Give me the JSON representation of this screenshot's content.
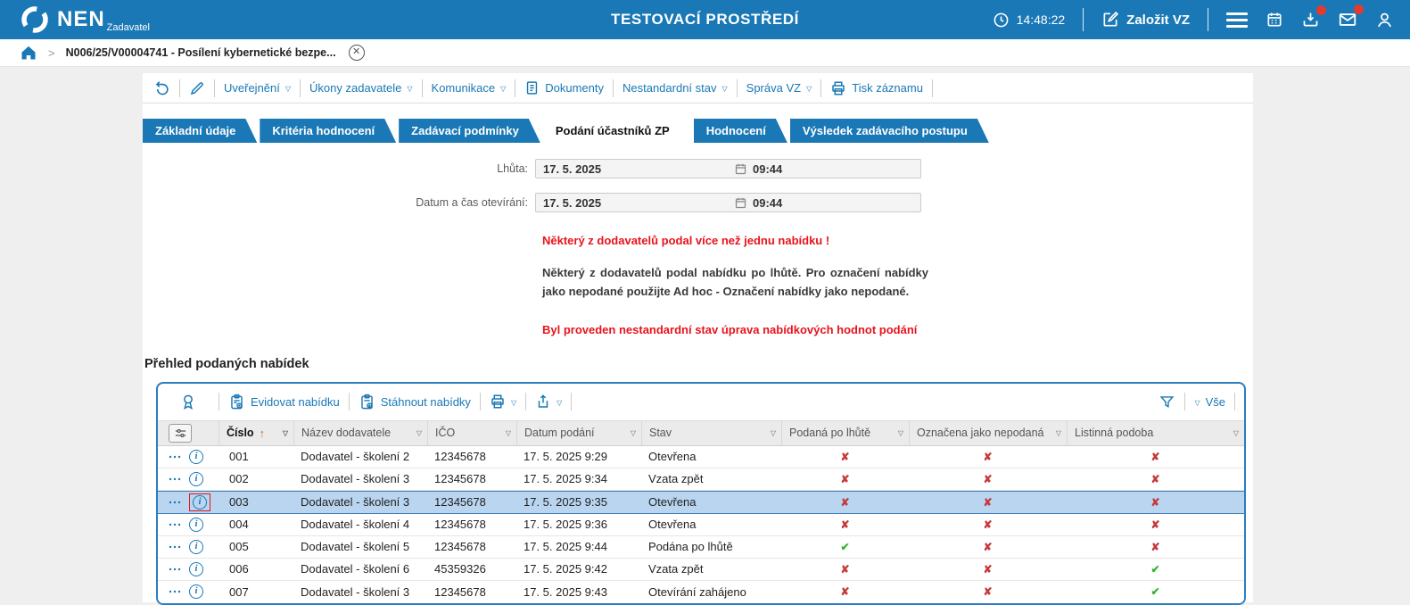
{
  "topbar": {
    "brand": "NEN",
    "brand_sub": "Zadavatel",
    "env_title": "TESTOVACÍ PROSTŘEDÍ",
    "time": "14:48:22",
    "create_vz_label": "Založit VZ"
  },
  "breadcrumb": {
    "item": "N006/25/V00004741 - Posílení kybernetické bezpe..."
  },
  "toolbar": {
    "uverejneni": "Uveřejnění",
    "ukony_zadavatele": "Úkony zadavatele",
    "komunikace": "Komunikace",
    "dokumenty": "Dokumenty",
    "nestandardni_stav": "Nestandardní stav",
    "sprava_vz": "Správa VZ",
    "tisk_zaznamu": "Tisk záznamu"
  },
  "tabs": [
    "Základní údaje",
    "Kritéria hodnocení",
    "Zadávací podmínky",
    "Podání účastníků ZP",
    "Hodnocení",
    "Výsledek zadávacího postupu"
  ],
  "active_tab": "Podání účastníků ZP",
  "form": {
    "deadline_label": "Lhůta:",
    "deadline_date": "17. 5. 2025",
    "deadline_time": "09:44",
    "opening_label": "Datum a čas otevírání:",
    "opening_date": "17. 5. 2025",
    "opening_time": "09:44"
  },
  "messages": {
    "warning_multiple": "Některý z dodavatelů podal více než jednu nabídku !",
    "info_late": "Některý z dodavatelů podal nabídku po lhůtě. Pro označení nabídky jako nepodané použijte Ad hoc - Označení nabídky jako nepodané.",
    "warning_nonstandard": "Byl proveden nestandardní stav úprava nabídkových hodnot podání"
  },
  "overview": {
    "title": "Přehled podaných nabídek",
    "toolbar": {
      "evidovat": "Evidovat nabídku",
      "stahnout": "Stáhnout nabídky",
      "all_filter": "Vše"
    },
    "columns": [
      "Číslo",
      "Název dodavatele",
      "IČO",
      "Datum podání",
      "Stav",
      "Podaná po lhůtě",
      "Označena jako nepodaná",
      "Listinná podoba"
    ],
    "rows": [
      {
        "cislo": "001",
        "nazev": "Dodavatel - školení 2",
        "ico": "12345678",
        "datum": "17. 5. 2025 9:29",
        "stav": "Otevřena",
        "po_lhute": false,
        "nepodana": false,
        "listinna": false,
        "selected": false
      },
      {
        "cislo": "002",
        "nazev": "Dodavatel - školení 3",
        "ico": "12345678",
        "datum": "17. 5. 2025 9:34",
        "stav": "Vzata zpět",
        "po_lhute": false,
        "nepodana": false,
        "listinna": false,
        "selected": false
      },
      {
        "cislo": "003",
        "nazev": "Dodavatel - školení 3",
        "ico": "12345678",
        "datum": "17. 5. 2025 9:35",
        "stav": "Otevřena",
        "po_lhute": false,
        "nepodana": false,
        "listinna": false,
        "selected": true
      },
      {
        "cislo": "004",
        "nazev": "Dodavatel - školení 4",
        "ico": "12345678",
        "datum": "17. 5. 2025 9:36",
        "stav": "Otevřena",
        "po_lhute": false,
        "nepodana": false,
        "listinna": false,
        "selected": false
      },
      {
        "cislo": "005",
        "nazev": "Dodavatel - školení 5",
        "ico": "12345678",
        "datum": "17. 5. 2025 9:44",
        "stav": "Podána po lhůtě",
        "po_lhute": true,
        "nepodana": false,
        "listinna": false,
        "selected": false
      },
      {
        "cislo": "006",
        "nazev": "Dodavatel - školení 6",
        "ico": "45359326",
        "datum": "17. 5. 2025 9:42",
        "stav": "Vzata zpět",
        "po_lhute": false,
        "nepodana": false,
        "listinna": true,
        "selected": false
      },
      {
        "cislo": "007",
        "nazev": "Dodavatel - školení 3",
        "ico": "12345678",
        "datum": "17. 5. 2025 9:43",
        "stav": "Otevírání zahájeno",
        "po_lhute": false,
        "nepodana": false,
        "listinna": true,
        "selected": false
      }
    ]
  },
  "colors": {
    "accent": "#1978b5",
    "warning_red": "#e8131c",
    "check_green": "#35b335",
    "cross_red": "#c5393c",
    "selected_row": "#b9d5f0"
  }
}
